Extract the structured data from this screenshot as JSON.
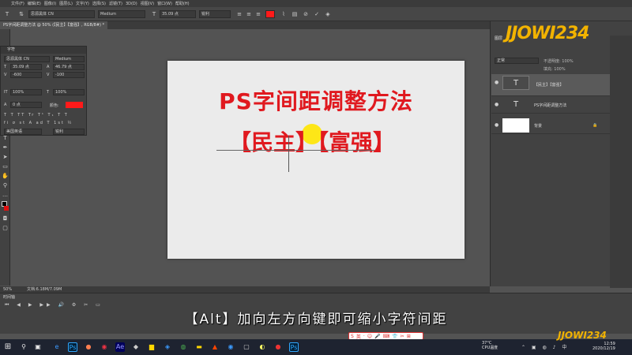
{
  "menubar": {
    "items": [
      "文件(F)",
      "编辑(E)",
      "图像(I)",
      "图层(L)",
      "文字(Y)",
      "选择(S)",
      "滤镜(T)",
      "3D(D)",
      "视图(V)",
      "窗口(W)",
      "帮助(H)"
    ]
  },
  "options": {
    "font_family": "思源黑体 CN",
    "font_style": "Medium",
    "font_size": "35.09 点",
    "antialias": "锐利",
    "text_color": "#ff1a1a"
  },
  "document": {
    "tab_label": "PS字间距调整方法 @ 50% (【民主】【富强】, RGB/8#) *",
    "title_text": "PS字间距调整方法",
    "bracket_text": "【民主】【富强】"
  },
  "character_panel": {
    "title": "字符",
    "font_family": "思源黑体 CN",
    "font_style": "Medium",
    "size": "35.09 点",
    "leading": "46.79 点",
    "kerning": "-600",
    "tracking": "-100",
    "vscale": "100%",
    "hscale": "100%",
    "baseline": "0 点",
    "color_label": "颜色:",
    "language": "美国英语",
    "antialias": "锐利"
  },
  "layers": {
    "tab_label": "图层",
    "blend_mode": "正常",
    "opacity_label": "不透明度: 100%",
    "fill_label": "填充: 100%",
    "items": [
      {
        "name": "【民主】【富强】",
        "thumb": "T"
      },
      {
        "name": "PS字间距调整方法",
        "thumb": "T"
      },
      {
        "name": "背景",
        "thumb": ""
      }
    ]
  },
  "status": {
    "zoom": "50%",
    "doc_info": "文档:6.18M/7.09M"
  },
  "timeline": {
    "title": "时间轴"
  },
  "subtitle": "【Alt】加向左方向键即可缩小字符间距",
  "ime_items": [
    "S",
    "英",
    "·",
    "☺",
    "🎤",
    "⌨",
    "👕",
    "✂",
    "⊞"
  ],
  "watermark": "JJOWI234",
  "tray": {
    "temp": "37°C",
    "cpu": "CPU温度"
  },
  "clock": {
    "time": "12:59",
    "date": "2020/12/19"
  }
}
